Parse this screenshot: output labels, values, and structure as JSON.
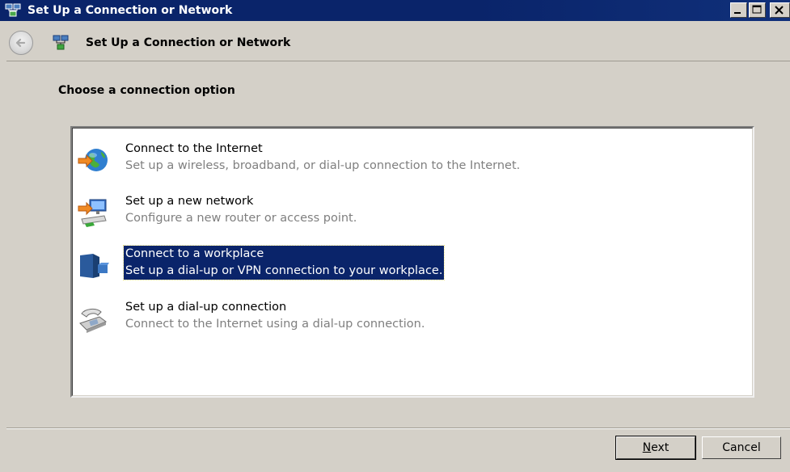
{
  "window": {
    "title": "Set Up a Connection or Network",
    "title_icon": "network-setup-icon",
    "controls": [
      "minimize-icon",
      "maximize-icon",
      "close-icon"
    ]
  },
  "header": {
    "back_icon": "back-arrow-icon",
    "icon": "network-setup-icon",
    "title": "Set Up a Connection or Network"
  },
  "main": {
    "heading": "Choose a connection option",
    "options": [
      {
        "title": "Connect to the Internet",
        "description": "Set up a wireless, broadband, or dial-up connection to the Internet.",
        "icon": "internet-globe-icon",
        "selected": false
      },
      {
        "title": "Set up a new network",
        "description": "Configure a new router or access point.",
        "icon": "new-network-router-icon",
        "selected": false
      },
      {
        "title": "Connect to a workplace",
        "description": "Set up a dial-up or VPN connection to your workplace.",
        "icon": "workplace-building-icon",
        "selected": true
      },
      {
        "title": "Set up a dial-up connection",
        "description": "Connect to the Internet using a dial-up connection.",
        "icon": "dialup-phone-icon",
        "selected": false
      }
    ]
  },
  "footer": {
    "next_label_first": "N",
    "next_label_rest": "ext",
    "cancel_label": "Cancel"
  },
  "colors": {
    "titlebar": "#0a246a",
    "dialog_bg": "#d4d0c8",
    "selection": "#0a246a",
    "description_text": "#7f7f7f"
  }
}
